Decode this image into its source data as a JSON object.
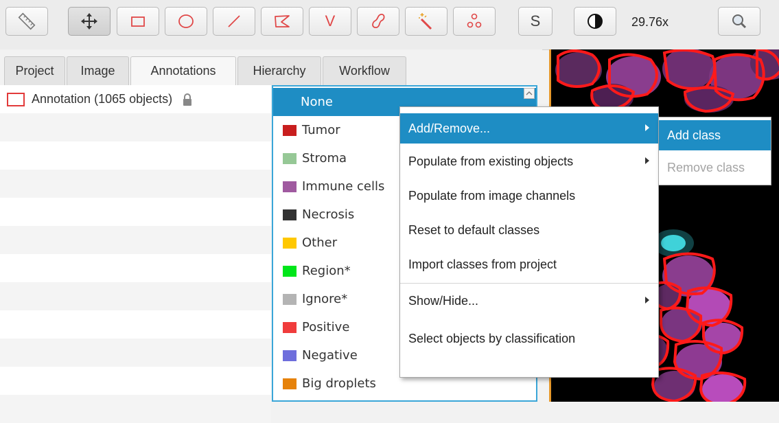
{
  "toolbar": {
    "tools": [
      {
        "name": "ruler-icon"
      },
      {
        "name": "move-icon"
      },
      {
        "name": "rectangle-icon"
      },
      {
        "name": "ellipse-icon"
      },
      {
        "name": "line-icon"
      },
      {
        "name": "polygon-icon"
      },
      {
        "name": "polyline-icon"
      },
      {
        "name": "brush-icon"
      },
      {
        "name": "wand-icon"
      },
      {
        "name": "points-icon"
      },
      {
        "name": "selection-mode-icon"
      },
      {
        "name": "contrast-icon"
      },
      {
        "name": "zoom-icon"
      }
    ],
    "selection_label": "S",
    "polyline_label": "V",
    "zoom_value": "29.76x"
  },
  "tabs": [
    "Project",
    "Image",
    "Annotations",
    "Hierarchy",
    "Workflow"
  ],
  "selected_tab": "Annotations",
  "annotation": {
    "label": "Annotation (1065 objects)",
    "color": "#e23a3a"
  },
  "class_list": {
    "selected": "None",
    "items": [
      {
        "label": "None",
        "color": ""
      },
      {
        "label": "Tumor",
        "color": "#c81e1e"
      },
      {
        "label": "Stroma",
        "color": "#96c896"
      },
      {
        "label": "Immune cells",
        "color": "#a05aa0"
      },
      {
        "label": "Necrosis",
        "color": "#323232"
      },
      {
        "label": "Other",
        "color": "#ffc800"
      },
      {
        "label": "Region*",
        "color": "#00e61a"
      },
      {
        "label": "Ignore*",
        "color": "#b4b4b4"
      },
      {
        "label": "Positive",
        "color": "#f03c3c"
      },
      {
        "label": "Negative",
        "color": "#6e6edc"
      },
      {
        "label": "Big droplets",
        "color": "#e6820a"
      }
    ]
  },
  "context_menu": {
    "items": [
      {
        "label": "Add/Remove...",
        "submenu": true
      },
      {
        "label": "Populate from existing objects",
        "submenu": true
      },
      {
        "label": "Populate from image channels",
        "submenu": false
      },
      {
        "label": "Reset to default classes",
        "submenu": false
      },
      {
        "label": "Import classes from project",
        "submenu": false
      },
      {
        "label": "Show/Hide...",
        "submenu": true
      },
      {
        "label": "Select objects by classification",
        "submenu": false
      }
    ],
    "submenu_items": [
      {
        "label": "Add class",
        "enabled": true
      },
      {
        "label": "Remove class",
        "enabled": false
      }
    ]
  },
  "colors": {
    "accent": "#1e8dc4",
    "annotation_red": "#e23a3a",
    "viewer_border": "#e89a2c"
  }
}
